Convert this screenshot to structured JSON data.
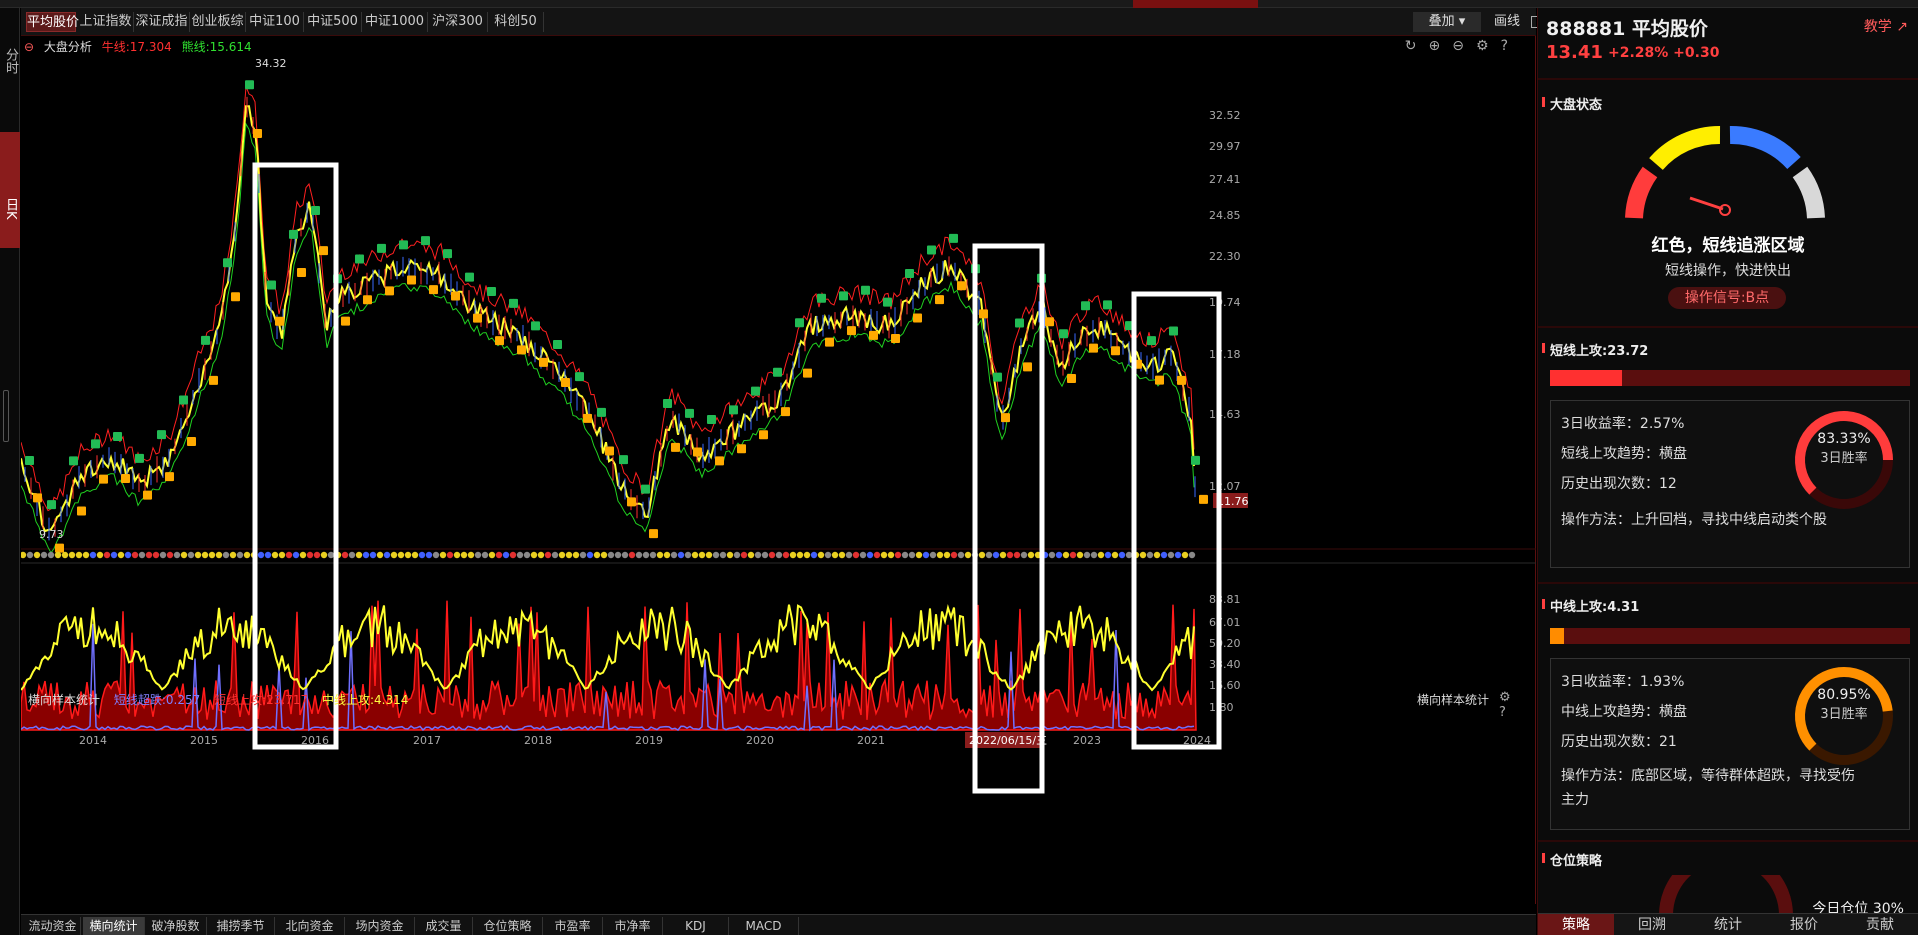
{
  "tabs": [
    "平均股价",
    "上证指数",
    "深证成指",
    "创业板综",
    "中证100",
    "中证500",
    "中证1000",
    "沪深300",
    "科创50"
  ],
  "toolbar": {
    "overlay": "叠加",
    "draw": "画线"
  },
  "left_rail": {
    "fenshi": "分时",
    "rik": "日K"
  },
  "chart_header": {
    "name": "大盘分析",
    "bull": "牛线:17.304",
    "bear": "熊线:15.614"
  },
  "main_price_labels": [
    "32.52",
    "29.97",
    "27.41",
    "24.85",
    "22.30",
    "19.74",
    "17.18",
    "14.63",
    "12.07"
  ],
  "last_price_tag": "11.76",
  "annotations": {
    "high": "34.32",
    "low": "9.73"
  },
  "sub_header": {
    "name": "横向样本统计",
    "short_drop": "短线超跌:0.257",
    "short_up": "短线上攻:23.717",
    "mid_up": "中线上攻:4.314",
    "right_name": "横向样本统计"
  },
  "sub_price_labels": [
    "83.81",
    "67.01",
    "50.20",
    "33.40",
    "16.60",
    "1.80"
  ],
  "years": [
    "2014",
    "2015",
    "2016",
    "2017",
    "2018",
    "2019",
    "2020",
    "2021",
    "2022/06/15/三",
    "2023",
    "2024"
  ],
  "bottom_tabs": [
    "流动资金",
    "横向统计",
    "破净股数",
    "捕捞季节",
    "北向资金",
    "场内资金",
    "成交量",
    "仓位策略",
    "市盈率",
    "市净率",
    "KDJ",
    "MACD"
  ],
  "right_panel": {
    "code_name": "888881 平均股价",
    "teach": "教学",
    "price": "13.41",
    "change": "+2.28% +0.30",
    "market_state_title": "大盘状态",
    "gauge_label": "红色，短线追涨区域",
    "gauge_desc": "短线操作，快进快出",
    "signal": "操作信号:B点",
    "short": {
      "title": "短线上攻:23.72",
      "fill": 0.2,
      "return": "3日收益率：2.57%",
      "trend": "短线上攻趋势：横盘",
      "count": "历史出现次数：12",
      "method": "操作方法：上升回档，寻找中线启动类个股",
      "win_pct": "83.33%",
      "win_label": "3日胜率"
    },
    "mid": {
      "title": "中线上攻:4.31",
      "fill": 0.04,
      "return": "3日收益率：1.93%",
      "trend": "中线上攻趋势：横盘",
      "count": "历史出现次数：21",
      "method1": "操作方法：底部区域，等待群体超跌，寻找受伤",
      "method2": "主力",
      "win_pct": "80.95%",
      "win_label": "3日胜率"
    },
    "position_title": "仓位策略",
    "position_today": "今日仓位 30%",
    "tabs": [
      "策略",
      "回溯",
      "统计",
      "报价",
      "贡献"
    ]
  }
}
